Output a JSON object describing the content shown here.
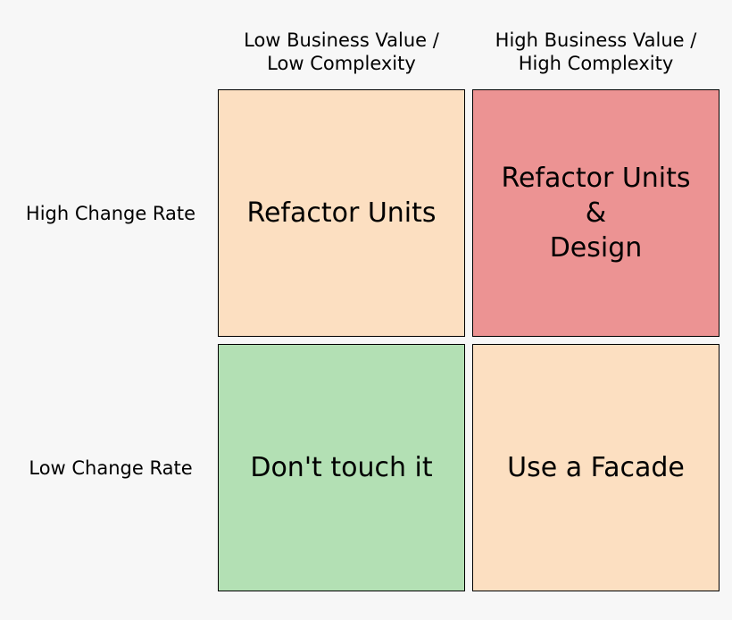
{
  "columns": {
    "left": "Low Business Value /\nLow Complexity",
    "right": "High Business Value /\nHigh Complexity"
  },
  "rows": {
    "top": "High Change Rate",
    "bottom": "Low Change Rate"
  },
  "cells": {
    "topLeft": "Refactor Units",
    "topRight": "Refactor Units\n&\nDesign",
    "bottomLeft": "Don't touch it",
    "bottomRight": "Use a Facade"
  },
  "colors": {
    "peach": "#fcdfc1",
    "red": "#ec9393",
    "green": "#b3e0b4"
  }
}
